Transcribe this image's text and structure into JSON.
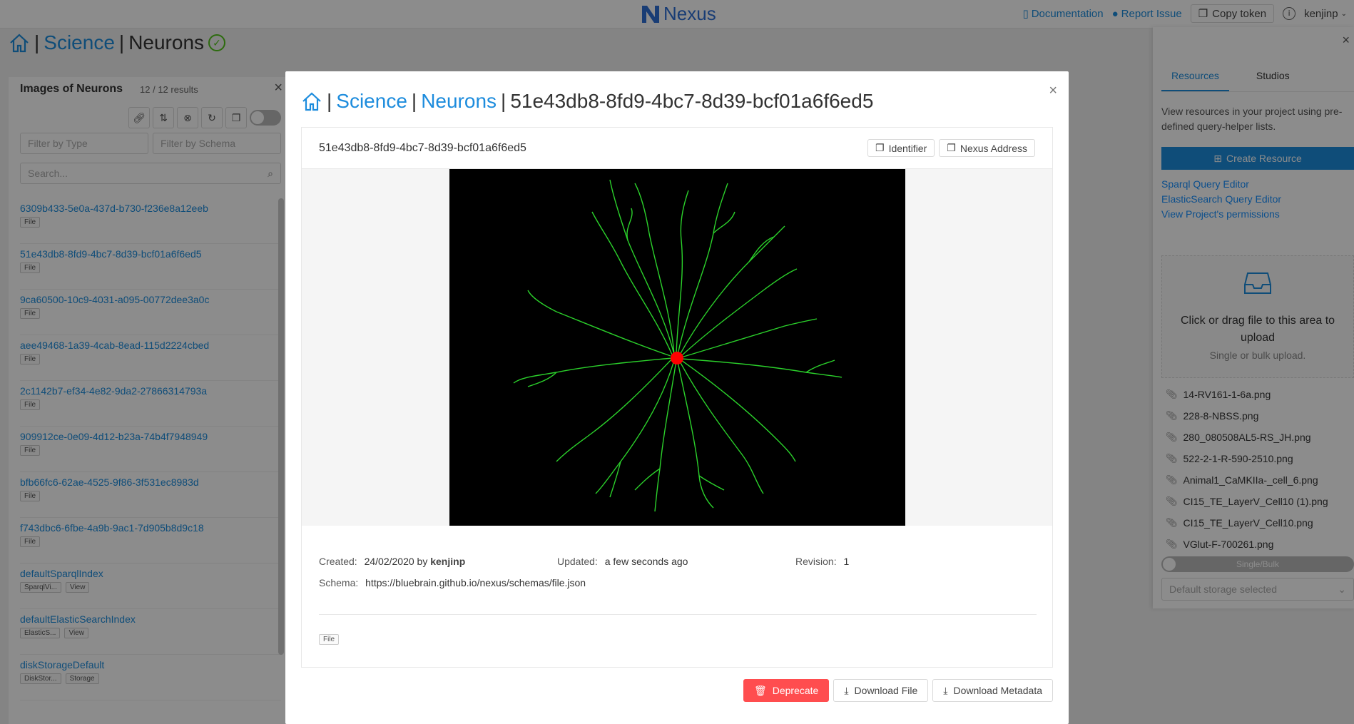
{
  "header": {
    "logo_text": "Nexus",
    "documentation": "Documentation",
    "report_issue": "Report Issue",
    "copy_token": "Copy token",
    "user": "kenjinp"
  },
  "page": {
    "crumb": {
      "org": "Science",
      "project": "Neurons",
      "sep": "|"
    }
  },
  "list_panel": {
    "title": "Images of Neurons",
    "count": "12 / 12 results",
    "filter_type": "Filter by Type",
    "filter_schema": "Filter by Schema",
    "search_placeholder": "Search...",
    "items": [
      {
        "title": "6309b433-5e0a-437d-b730-f236e8a12eeb",
        "tags": [
          "File"
        ]
      },
      {
        "title": "51e43db8-8fd9-4bc7-8d39-bcf01a6f6ed5",
        "tags": [
          "File"
        ]
      },
      {
        "title": "9ca60500-10c9-4031-a095-00772dee3a0c",
        "tags": [
          "File"
        ]
      },
      {
        "title": "aee49468-1a39-4cab-8ead-115d2224cbed",
        "tags": [
          "File"
        ]
      },
      {
        "title": "2c1142b7-ef34-4e82-9da2-27866314793a",
        "tags": [
          "File"
        ]
      },
      {
        "title": "909912ce-0e09-4d12-b23a-74b4f7948949",
        "tags": [
          "File"
        ]
      },
      {
        "title": "bfb66fc6-62ae-4525-9f86-3f531ec8983d",
        "tags": [
          "File"
        ]
      },
      {
        "title": "f743dbc6-6fbe-4a9b-9ac1-7d905b8d9c18",
        "tags": [
          "File"
        ]
      },
      {
        "title": "defaultSparqlIndex",
        "tags": [
          "SparqlVi...",
          "View"
        ]
      },
      {
        "title": "defaultElasticSearchIndex",
        "tags": [
          "ElasticS...",
          "View"
        ]
      },
      {
        "title": "diskStorageDefault",
        "tags": [
          "DiskStor...",
          "Storage"
        ]
      }
    ]
  },
  "right_panel": {
    "tabs": [
      "Resources",
      "Studios"
    ],
    "description": "View resources in your project using pre-defined query-helper lists.",
    "create_resource": "Create Resource",
    "links": [
      "Sparql Query Editor",
      "ElasticSearch Query Editor",
      "View Project's permissions"
    ],
    "upload_main": "Click or drag file to this area to upload",
    "upload_sub": "Single or bulk upload.",
    "files": [
      "14-RV161-1-6a.png",
      "228-8-NBSS.png",
      "280_080508AL5-RS_JH.png",
      "522-2-1-R-590-2510.png",
      "Animal1_CaMKIIa-_cell_6.png",
      "CI15_TE_LayerV_Cell10 (1).png",
      "CI15_TE_LayerV_Cell10.png",
      "VGlut-F-700261.png"
    ],
    "switch_label": "Single/Bulk",
    "storage_placeholder": "Default storage selected"
  },
  "modal": {
    "crumb": {
      "org": "Science",
      "project": "Neurons",
      "id": "51e43db8-8fd9-4bc7-8d39-bcf01a6f6ed5"
    },
    "card_title": "51e43db8-8fd9-4bc7-8d39-bcf01a6f6ed5",
    "identifier_button": "Identifier",
    "address_button": "Nexus Address",
    "created_label": "Created:",
    "created_value": "24/02/2020 by",
    "created_by": "kenjinp",
    "updated_label": "Updated:",
    "updated_value": "a few seconds ago",
    "revision_label": "Revision:",
    "revision_value": "1",
    "schema_label": "Schema:",
    "schema_value": "https://bluebrain.github.io/nexus/schemas/file.json",
    "type_tag": "File",
    "deprecate_button": "Deprecate",
    "download_file_button": "Download File",
    "download_metadata_button": "Download Metadata"
  },
  "colors": {
    "accent": "#1d8cdd",
    "danger": "#ff4d4f",
    "neuron": "#2bd12b",
    "soma": "#ff0000"
  },
  "icons": [
    "home-icon",
    "check-circle-icon",
    "link-icon",
    "sort-icon",
    "clear-icon",
    "refresh-icon",
    "copy-icon",
    "search-icon",
    "close-icon",
    "inbox-icon",
    "paperclip-icon",
    "trash-icon",
    "download-icon",
    "github-icon",
    "book-icon",
    "info-icon",
    "chevron-down-icon",
    "plus-icon"
  ]
}
